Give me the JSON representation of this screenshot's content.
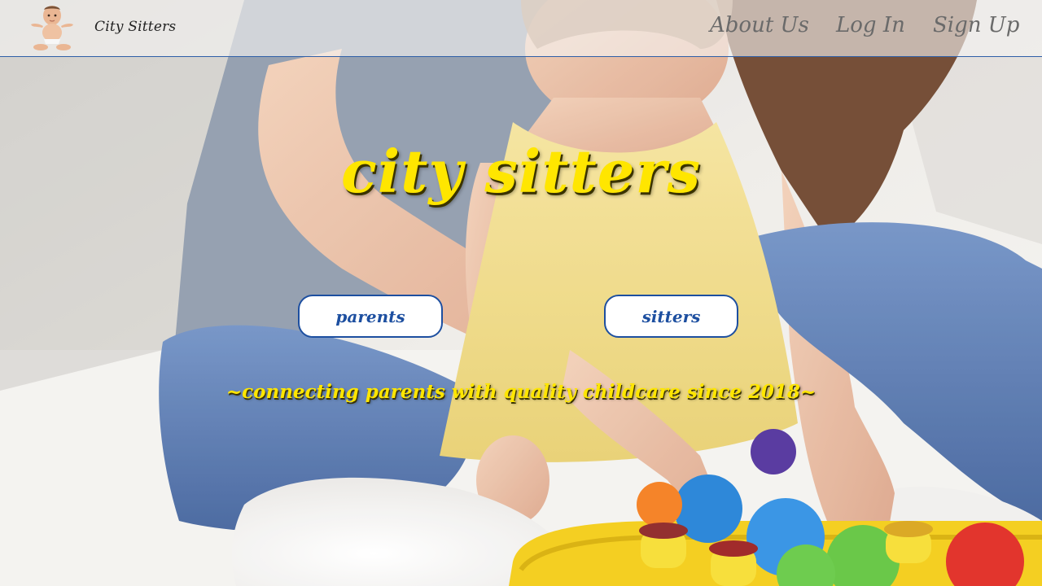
{
  "brand": {
    "name": "City Sitters",
    "logo_icon": "baby-icon"
  },
  "nav": {
    "items": [
      {
        "label": "About Us"
      },
      {
        "label": "Log In"
      },
      {
        "label": "Sign Up"
      }
    ]
  },
  "hero": {
    "title": "city sitters",
    "buttons": {
      "parents": "parents",
      "sitters": "sitters"
    },
    "tagline": "~connecting parents with quality childcare since 2018~"
  },
  "colors": {
    "accent_yellow": "#ffe600",
    "brand_blue": "#1d4fa0",
    "nav_text": "#6a6a6a"
  }
}
